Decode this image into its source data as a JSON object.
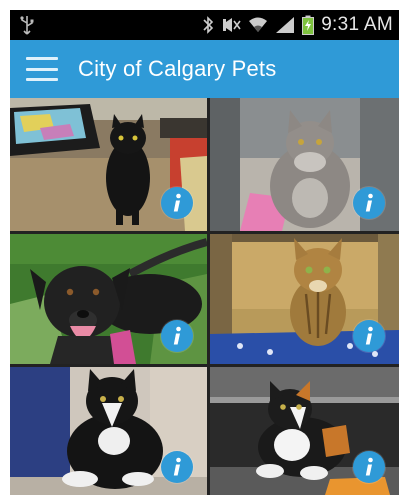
{
  "status_bar": {
    "time": "9:31 AM",
    "icons": [
      "usb-icon",
      "bluetooth-icon",
      "mute-icon",
      "wifi-icon",
      "signal-icon",
      "battery-icon"
    ]
  },
  "app_bar": {
    "title": "City of Calgary Pets",
    "menu_icon": "hamburger-menu-icon",
    "color": "#2f9ad7"
  },
  "pets": [
    {
      "photo": "black-cat-photo",
      "info_icon": "info-icon"
    },
    {
      "photo": "gray-longhair-cat-photo",
      "info_icon": "info-icon"
    },
    {
      "photo": "black-dog-photo",
      "info_icon": "info-icon"
    },
    {
      "photo": "tabby-cat-photo",
      "info_icon": "info-icon"
    },
    {
      "photo": "tuxedo-cat-photo",
      "info_icon": "info-icon"
    },
    {
      "photo": "calico-cat-photo",
      "info_icon": "info-icon"
    }
  ]
}
